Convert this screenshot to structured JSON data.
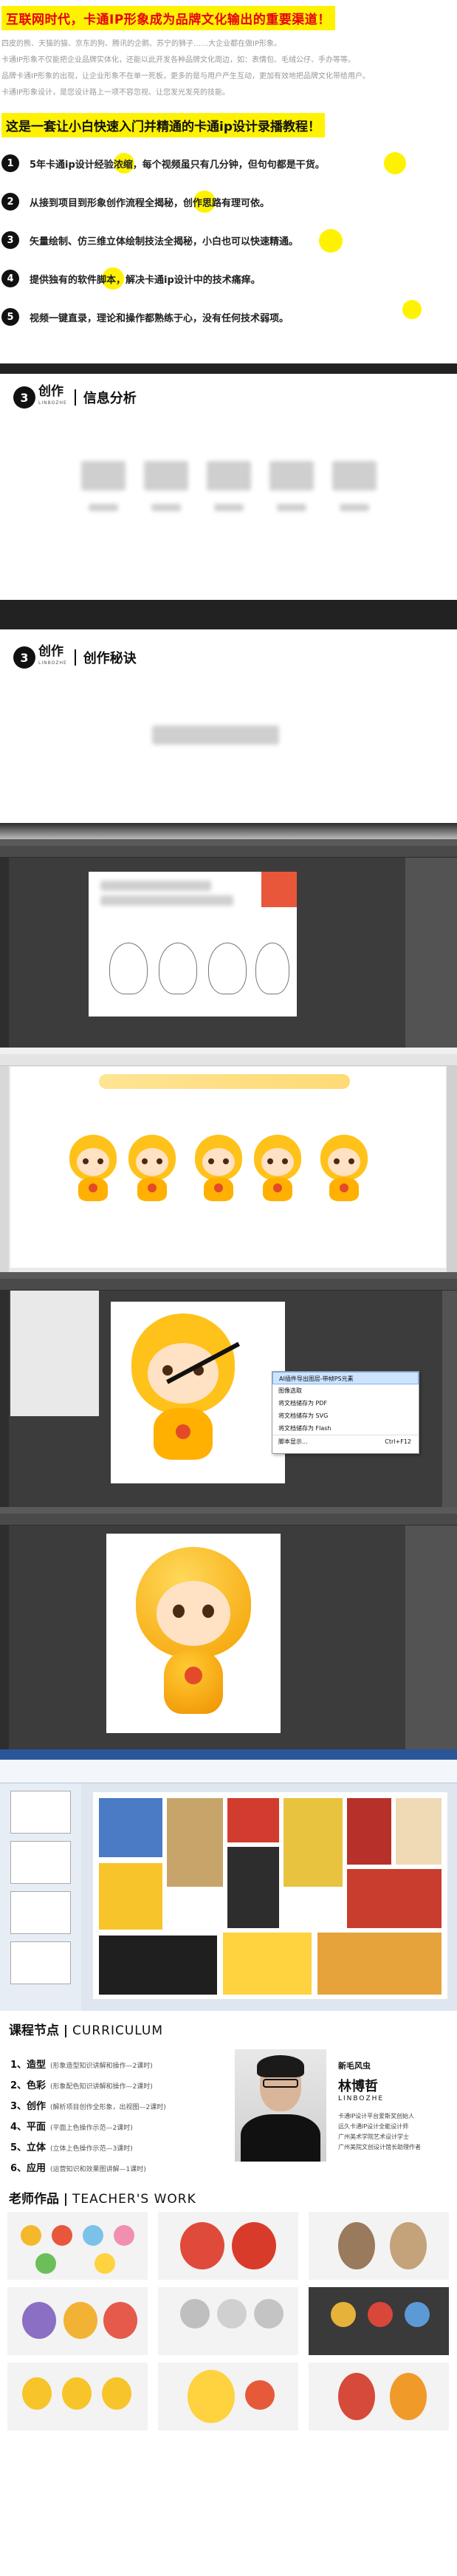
{
  "intro": {
    "headline": "互联网时代，卡通IP形象成为品牌文化输出的重要渠道！",
    "paragraphs": [
      "四皮的熊、天猫的猫、京东的狗、腾讯的企鹅、苏宁的狮子……大企业都在做IP形象。",
      "卡通IP形象不仅能把企业品牌实体化，还能以此开发各种品牌文化周边，如：表情包、毛绒公仔、手办等等。",
      "品牌卡通IP形象的出现，让企业形象不在单一死板，更多的是与用户产生互动，更加有效地把品牌文化带给用户。",
      "卡通IP形象设计，是您设计路上一项不容忽视、让您发光发亮的技能。"
    ],
    "subtitle": "这是一套让小白快速入门并精通的卡通ip设计录播教程！",
    "features": [
      {
        "num": "1",
        "text": "5年卡通ip设计经验浓缩，每个视频虽只有几分钟，但句句都是干货。"
      },
      {
        "num": "2",
        "text": "从接到项目到形象创作流程全揭秘，创作思路有理可依。"
      },
      {
        "num": "3",
        "text": "矢量绘制、仿三维立体绘制技法全揭秘，小白也可以快速精通。"
      },
      {
        "num": "4",
        "text": "提供独有的软件脚本，解决卡通ip设计中的技术痛痒。"
      },
      {
        "num": "5",
        "text": "视频一键直录，理论和操作都熟练于心，没有任何技术弱项。"
      }
    ]
  },
  "brand": {
    "num": "3",
    "word": "创作",
    "tag": "LINBOZHE"
  },
  "sections": {
    "info": "信息分析",
    "secret": "创作秘诀"
  },
  "menu": {
    "items": [
      "AI插件导出图层-带帧PS元素",
      "图像选取",
      "将文档储存为 PDF",
      "将文档储存为 SVG",
      "将文档储存为 Flash",
      "脚本显示..."
    ],
    "shortcut": "Ctrl+F12"
  },
  "curriculum": {
    "title": "课程节点",
    "title_en": "CURRICULUM",
    "items": [
      {
        "label": "1、造型",
        "note": "(形象造型知识讲解和操作—2课时)"
      },
      {
        "label": "2、色彩",
        "note": "(形象配色知识讲解和操作—2课时)"
      },
      {
        "label": "3、创作",
        "note": "(解析项目创作全形象，出视图—2课时)"
      },
      {
        "label": "4、平面",
        "note": "(平面上色操作示范—2课时)"
      },
      {
        "label": "5、立体",
        "note": "(立体上色操作示范—3课时)"
      },
      {
        "label": "6、应用",
        "note": "(运营知识和效果图讲解—1课时)"
      }
    ],
    "teacher": {
      "sub": "新毛风虫",
      "name": "林博哲",
      "en": "LINBOZHE",
      "desc": [
        "卡通IP设计平台爱斯奖创始人",
        "远久卡通IP设计全能设计师",
        "广州美术学院艺术设计学士",
        "广州美院文创设计馆长助理作者"
      ]
    }
  },
  "works": {
    "title": "老师作品",
    "title_en": "TEACHER'S WORK"
  },
  "colors": {
    "accent": "#fff200",
    "red": "#e60012",
    "mascot": "#ffc21a"
  }
}
